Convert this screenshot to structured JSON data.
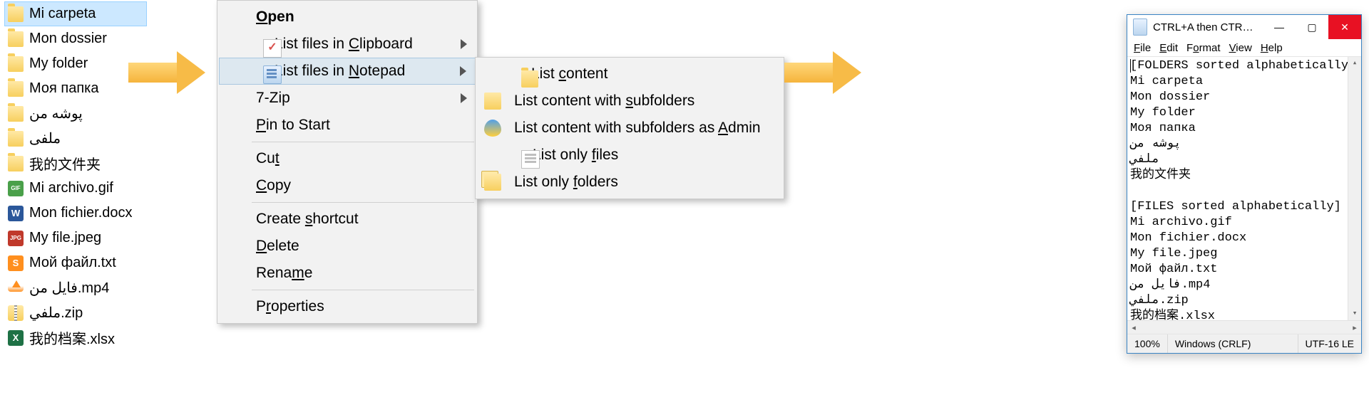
{
  "filelist": {
    "items": [
      {
        "name": "Mi carpeta",
        "icon": "folder",
        "selected": true
      },
      {
        "name": "Mon dossier",
        "icon": "folder",
        "selected": false
      },
      {
        "name": "My folder",
        "icon": "folder",
        "selected": false
      },
      {
        "name": "Моя папка",
        "icon": "folder",
        "selected": false
      },
      {
        "name": "پوشه من",
        "icon": "folder",
        "selected": false
      },
      {
        "name": "ملفى",
        "icon": "folder",
        "selected": false
      },
      {
        "name": "我的文件夹",
        "icon": "folder",
        "selected": false
      },
      {
        "name": "Mi archivo.gif",
        "icon": "gif",
        "selected": false
      },
      {
        "name": "Mon fichier.docx",
        "icon": "doc",
        "selected": false
      },
      {
        "name": "My file.jpeg",
        "icon": "jpeg",
        "selected": false
      },
      {
        "name": "Мой файл.txt",
        "icon": "txt",
        "selected": false
      },
      {
        "name": "فایل من.mp4",
        "icon": "mp4",
        "selected": false
      },
      {
        "name": "ملفي.zip",
        "icon": "zip",
        "selected": false
      },
      {
        "name": "我的档案.xlsx",
        "icon": "xlsx",
        "selected": false
      }
    ]
  },
  "contextmenu": {
    "open": {
      "pre": "",
      "u": "O",
      "post": "pen"
    },
    "list_clipboard": {
      "pre": "List files in ",
      "u": "C",
      "post": "lipboard"
    },
    "list_notepad": {
      "pre": "List files in ",
      "u": "N",
      "post": "otepad"
    },
    "seven_zip": {
      "text": "7-Zip"
    },
    "pin_to_start": {
      "pre": "",
      "u": "P",
      "post": "in to Start"
    },
    "cut": {
      "pre": "Cu",
      "u": "t",
      "post": ""
    },
    "copy": {
      "pre": "",
      "u": "C",
      "post": "opy"
    },
    "create_shortcut": {
      "pre": "Create ",
      "u": "s",
      "post": "hortcut"
    },
    "delete": {
      "pre": "",
      "u": "D",
      "post": "elete"
    },
    "rename": {
      "pre": "Rena",
      "u": "m",
      "post": "e"
    },
    "properties": {
      "pre": "P",
      "u": "r",
      "post": "operties"
    }
  },
  "submenu": {
    "list_content": {
      "pre": "List ",
      "u": "c",
      "post": "ontent"
    },
    "list_subfolders": {
      "pre": "List content with ",
      "u": "s",
      "post": "ubfolders"
    },
    "list_admin": {
      "pre": "List content with subfolders as ",
      "u": "A",
      "post": "dmin"
    },
    "list_only_files": {
      "pre": "List only ",
      "u": "f",
      "post": "iles"
    },
    "list_only_folders": {
      "pre": "List only ",
      "u": "f",
      "post": "olders"
    }
  },
  "notepad": {
    "title": "CTRL+A then CTR…",
    "menubar": {
      "file": {
        "u": "F",
        "post": "ile"
      },
      "edit": {
        "u": "E",
        "post": "dit"
      },
      "format": {
        "pre": "F",
        "u": "o",
        "post": "rmat"
      },
      "view": {
        "u": "V",
        "post": "iew"
      },
      "help": {
        "u": "H",
        "post": "elp"
      }
    },
    "body_lines": [
      "[FOLDERS sorted alphabetically]",
      "Mi carpeta",
      "Mon dossier",
      "My folder",
      "Моя папка",
      "پوشه من",
      "ملفي",
      "我的文件夹",
      "",
      "[FILES sorted alphabetically]",
      "Mi archivo.gif",
      "Mon fichier.docx",
      "My file.jpeg",
      "Мой файл.txt",
      "فایل من.mp4",
      "ملفي.zip",
      "我的档案.xlsx"
    ],
    "status": {
      "zoom": "100%",
      "eol": "Windows (CRLF)",
      "enc": "UTF-16 LE"
    }
  }
}
